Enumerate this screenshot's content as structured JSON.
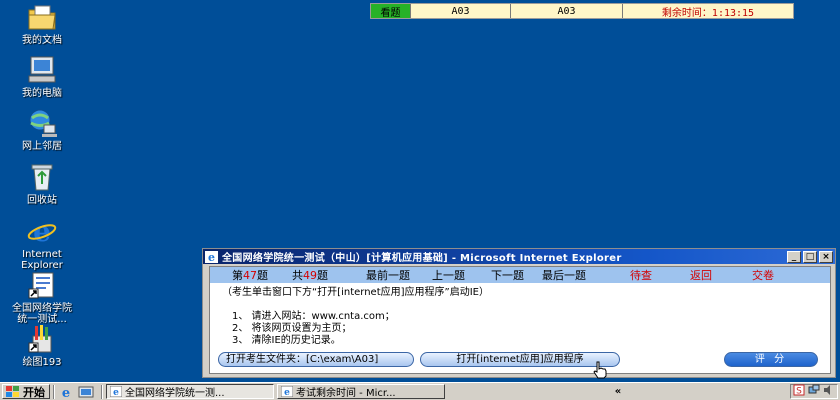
{
  "desktop": {
    "icons": [
      {
        "label": "我的文档",
        "icon": "my-documents-icon"
      },
      {
        "label": "我的电脑",
        "icon": "my-computer-icon"
      },
      {
        "label": "网上邻居",
        "icon": "network-places-icon"
      },
      {
        "label": "回收站",
        "icon": "recycle-bin-icon"
      },
      {
        "label": "Internet\nExplorer",
        "icon": "internet-explorer-icon"
      },
      {
        "label": "全国网络学院\n统一测试...",
        "icon": "shortcut-icon"
      },
      {
        "label": "绘图193",
        "icon": "paint-icon"
      }
    ]
  },
  "exam_bar": {
    "view_label": "看题",
    "field1": "A03",
    "field2": "A03",
    "time_label": "剩余时间：1:13:15"
  },
  "ie_window": {
    "title": "全国网络学院统一测试（中山）[计算机应用基础] - Microsoft Internet Explorer",
    "controls": {
      "minimize": "_",
      "maximize": "□",
      "close": "×"
    },
    "nav": {
      "current_prefix": "第",
      "current_num": "47",
      "current_suffix": "题",
      "total_prefix": "共",
      "total_num": "49",
      "total_suffix": "题",
      "first": "最前一题",
      "prev": "上一题",
      "next": "下一题",
      "last": "最后一题",
      "review": "待查",
      "back": "返回",
      "submit": "交卷"
    },
    "instructions": [
      "（考生单击窗口下方“打开[internet应用]应用程序”启动IE）",
      "1、 请进入网站：www.cnta.com；",
      "2、 将该网页设置为主页；",
      "3、 清除IE的历史记录。"
    ],
    "buttons": {
      "open_folder": "打开考生文件夹：[C:\\exam\\A03]",
      "open_app": "打开[internet应用]应用程序",
      "score": "评 分"
    }
  },
  "taskbar": {
    "start": "开始",
    "tasks": [
      {
        "label": "全国网络学院统一测...",
        "active": true
      },
      {
        "label": "考试剩余时间 - Micr...",
        "active": false
      }
    ],
    "tray_chevron": "«"
  },
  "colors": {
    "desktop": "#004e98",
    "nav_bar": "#9ec3ee",
    "accent_red": "#d40000",
    "timer_bg": "#fff6c8",
    "view_green": "#27b227"
  }
}
